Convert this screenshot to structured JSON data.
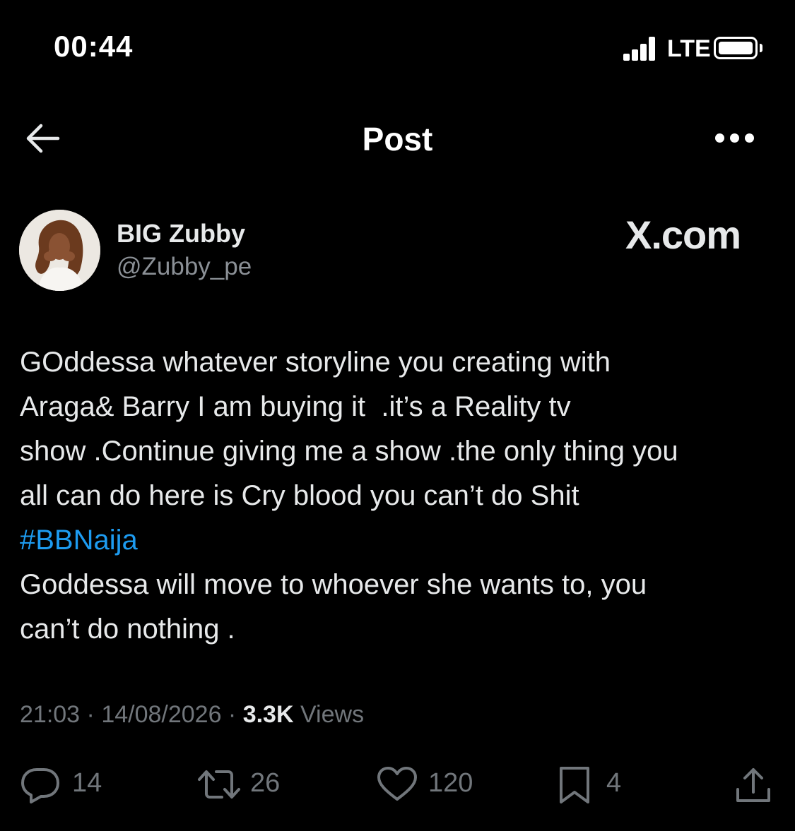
{
  "status_bar": {
    "time": "00:44",
    "network": "LTE",
    "icons": [
      "signal-icon",
      "battery-icon"
    ]
  },
  "header": {
    "title": "Post",
    "icons": [
      "back-arrow-icon",
      "more-options-icon"
    ]
  },
  "author": {
    "name": "BIG Zubby",
    "handle": "@Zubby_pe"
  },
  "watermark": "X.com",
  "tweet": {
    "lines": [
      "GOddessa whatever storyline you creating with",
      "Araga& Barry I am buying it  .it’s a Reality tv",
      "show .Continue giving me a show .the only thing you",
      "all can do here is Cry blood you can’t do Shit"
    ],
    "hashtag": "#BBNaija",
    "lines_after": [
      "Goddessa will move to whoever she wants to, you",
      "can’t do nothing ."
    ]
  },
  "meta": {
    "time": "21:03",
    "date": "14/08/2026",
    "views_count": "3.3K",
    "views_label": "Views",
    "separator": " · "
  },
  "actions": {
    "replies": "14",
    "reposts": "26",
    "likes": "120",
    "bookmarks": "4",
    "icons": [
      "reply-icon",
      "repost-icon",
      "like-icon",
      "bookmark-icon",
      "share-icon"
    ]
  },
  "colors": {
    "background": "#000000",
    "text": "#e7e9ea",
    "secondary": "#71767b",
    "link": "#1d9bf0"
  }
}
